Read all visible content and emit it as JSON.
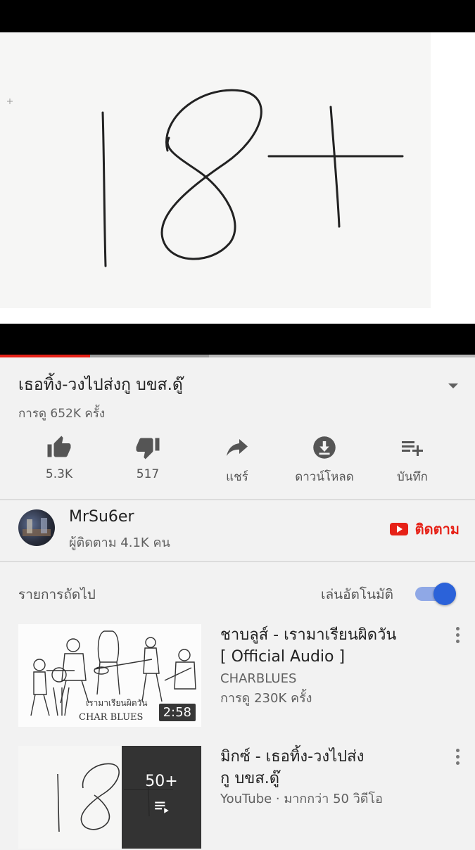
{
  "player": {
    "thumbnail_text": "18+",
    "progress_fraction": 0.19
  },
  "video": {
    "title": "เธอทิ้ง-วงไปส่งกู บขส.ดู๊",
    "views": "การดู 652K ครั้ง"
  },
  "actions": {
    "like": {
      "label": "5.3K",
      "icon": "thumb-up-icon"
    },
    "dislike": {
      "label": "517",
      "icon": "thumb-down-icon"
    },
    "share": {
      "label": "แชร์",
      "icon": "share-icon"
    },
    "download": {
      "label": "ดาวน์โหลด",
      "icon": "download-icon"
    },
    "save": {
      "label": "บันทึก",
      "icon": "playlist-add-icon"
    }
  },
  "channel": {
    "name": "MrSu6er",
    "subscribers": "ผู้ติดตาม 4.1K คน",
    "subscribe_label": "ติดตาม"
  },
  "up_next": {
    "label": "รายการถัดไป",
    "autoplay_label": "เล่นอัตโนมัติ",
    "autoplay_on": true
  },
  "items": [
    {
      "title_line1": "ชาบลูส์ - เรามาเรียนผิดวัน",
      "title_line2": "[ Official Audio ]",
      "channel": "CHARBLUES",
      "views": "การดู 230K ครั้ง",
      "duration": "2:58",
      "thumb_caption1": "เรามาเรียนผิดวัน",
      "thumb_caption2": "CHAR BLUES"
    },
    {
      "title_line1": "มิกซ์ - เธอทิ้ง-วงไปส่ง",
      "title_line2": "กู บขส.ดู๊",
      "meta": "YouTube · มากกว่า 50 วิดีโอ",
      "playlist_count": "50+"
    }
  ],
  "colors": {
    "accent_red": "#e62117",
    "toggle_blue": "#2b62d9"
  }
}
